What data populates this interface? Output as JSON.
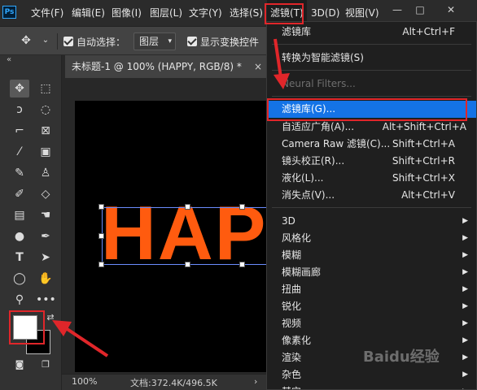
{
  "menubar": {
    "logo": "Ps",
    "items": [
      "文件(F)",
      "编辑(E)",
      "图像(I)",
      "图层(L)",
      "文字(Y)",
      "选择(S)",
      "滤镜(T)",
      "3D(D)",
      "视图(V)"
    ],
    "window_buttons": [
      "—",
      "□",
      "✕"
    ]
  },
  "options": {
    "auto_select_label": "自动选择：",
    "auto_select_value": "图层",
    "show_transform_label": "显示变换控件"
  },
  "document": {
    "tab_title": "未标题-1 @ 100% (HAPPY, RGB/8) *",
    "close": "×",
    "canvas_text": "HAPPY",
    "zoom": "100%",
    "doc_size": "文档:372.4K/496.5K",
    "status_arrow": "›"
  },
  "filter_menu": {
    "items": [
      {
        "label": "滤镜库",
        "shortcut": "Alt+Ctrl+F"
      },
      {
        "label": "转换为智能滤镜(S)",
        "shortcut": ""
      },
      {
        "label": "Neural Filters...",
        "shortcut": ""
      },
      {
        "label": "滤镜库(G)...",
        "shortcut": ""
      },
      {
        "label": "自适应广角(A)...",
        "shortcut": "Alt+Shift+Ctrl+A"
      },
      {
        "label": "Camera Raw 滤镜(C)...",
        "shortcut": "Shift+Ctrl+A"
      },
      {
        "label": "镜头校正(R)...",
        "shortcut": "Shift+Ctrl+R"
      },
      {
        "label": "液化(L)...",
        "shortcut": "Shift+Ctrl+X"
      },
      {
        "label": "消失点(V)...",
        "shortcut": "Alt+Ctrl+V"
      },
      {
        "label": "3D",
        "shortcut": ""
      },
      {
        "label": "风格化",
        "shortcut": ""
      },
      {
        "label": "模糊",
        "shortcut": ""
      },
      {
        "label": "模糊画廊",
        "shortcut": ""
      },
      {
        "label": "扭曲",
        "shortcut": ""
      },
      {
        "label": "锐化",
        "shortcut": ""
      },
      {
        "label": "视频",
        "shortcut": ""
      },
      {
        "label": "像素化",
        "shortcut": ""
      },
      {
        "label": "渲染",
        "shortcut": ""
      },
      {
        "label": "杂色",
        "shortcut": ""
      },
      {
        "label": "其它",
        "shortcut": ""
      }
    ]
  },
  "colors": {
    "highlight": "#1473e6",
    "annotation": "#e0262a",
    "text_fill": "#ff5b0f"
  },
  "watermark": "Baidu经验"
}
